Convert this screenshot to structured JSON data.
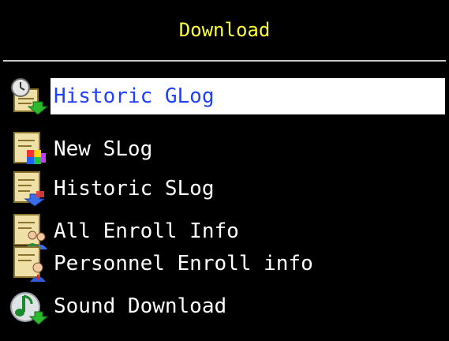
{
  "header": {
    "title": "Download"
  },
  "menu": {
    "items": [
      {
        "label": "Historic GLog",
        "icon": "clock-download-icon",
        "selected": true
      },
      {
        "label": "New SLog",
        "icon": "color-palette-icon",
        "selected": false
      },
      {
        "label": "Historic SLog",
        "icon": "scroll-download-icon",
        "selected": false
      },
      {
        "label": "All Enroll Info",
        "icon": "users-icon",
        "selected": false
      },
      {
        "label": "Personnel Enroll info",
        "icon": "person-icon",
        "selected": false
      },
      {
        "label": "Sound Download",
        "icon": "music-note-download-icon",
        "selected": false
      }
    ]
  },
  "colors": {
    "background": "#000000",
    "title": "#ffff33",
    "text": "#ffffff",
    "selected_text": "#2040ff",
    "highlight": "#ffffff"
  }
}
